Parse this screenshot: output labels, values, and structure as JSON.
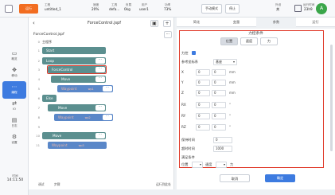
{
  "topbar": {
    "run_badge": "运行",
    "project_small": "工程",
    "project_name": "untitled_1",
    "speed_small": "速度",
    "speed_value": "20%",
    "tool_small": "工具",
    "tool_value": "defa...",
    "load_small": "负载",
    "load_value": "0kg",
    "user_small": "用户",
    "user_value": "user1",
    "power_small": "功率",
    "power_value": "73%",
    "btn_record": "手动模式",
    "btn_stop": "停止",
    "ext_small": "外设",
    "ext_value": "关",
    "time_small": "运行时间",
    "time_value": "23h9",
    "avatar": "A"
  },
  "sidebar": {
    "items": [
      {
        "label": "概览",
        "icon": "monitor-icon"
      },
      {
        "label": "移动",
        "icon": "move-icon"
      },
      {
        "label": "编程",
        "icon": "code-icon"
      },
      {
        "label": "IO",
        "icon": "io-icon"
      },
      {
        "label": "日志",
        "icon": "log-icon"
      },
      {
        "label": "设置",
        "icon": "gear-icon"
      }
    ],
    "clock_label": "时间",
    "clock_time": "14:11:50"
  },
  "program": {
    "title": "ForceControl.jspf",
    "file_name": "ForceControl.jspf",
    "root": "主程序",
    "lines": [
      {
        "n": "1",
        "text": "Start"
      },
      {
        "n": "2",
        "text": "Loop"
      },
      {
        "n": "3",
        "text": "ForceControl"
      },
      {
        "n": "4",
        "text": "Move"
      },
      {
        "n": "5",
        "text": "Waypoint",
        "chip": "wp1"
      },
      {
        "n": "6",
        "text": "Else"
      },
      {
        "n": "7",
        "text": "Move"
      },
      {
        "n": "8",
        "text": "Waypoint",
        "chip": "wp2"
      },
      {
        "n": "9",
        "text": ""
      },
      {
        "n": "10",
        "text": "Move"
      },
      {
        "n": "11",
        "text": "Waypoint",
        "chip": "wp3"
      }
    ],
    "footer_left": "调试",
    "footer_mid": "步骤",
    "footer_right": "运行到此处"
  },
  "tabs": [
    "简化",
    "变量",
    "参数",
    "运行"
  ],
  "active_tab": 2,
  "force": {
    "section_title": "力控条件",
    "segments": [
      "位置",
      "速度",
      "力"
    ],
    "enable_label": "力控",
    "ref_label": "参考坐标系",
    "ref_value": "基座",
    "axes": [
      {
        "axis": "X",
        "min": "0",
        "max": "0",
        "unit": "mm"
      },
      {
        "axis": "Y",
        "min": "0",
        "max": "0",
        "unit": "mm"
      },
      {
        "axis": "Z",
        "min": "0",
        "max": "0",
        "unit": "mm"
      },
      {
        "axis": "RX",
        "min": "0",
        "max": "0",
        "unit": "°"
      },
      {
        "axis": "RY",
        "min": "0",
        "max": "0",
        "unit": "°"
      },
      {
        "axis": "RZ",
        "min": "0",
        "max": "0",
        "unit": "°"
      }
    ],
    "delay_label": "保持时间",
    "delay_value": "0",
    "timeout_label": "超时时间",
    "timeout_value": "1000",
    "cond_label": "满足条件",
    "cond_a": "位置",
    "cond_b": "速度",
    "cond_c": "力",
    "cancel": "取消",
    "confirm": "确定"
  }
}
